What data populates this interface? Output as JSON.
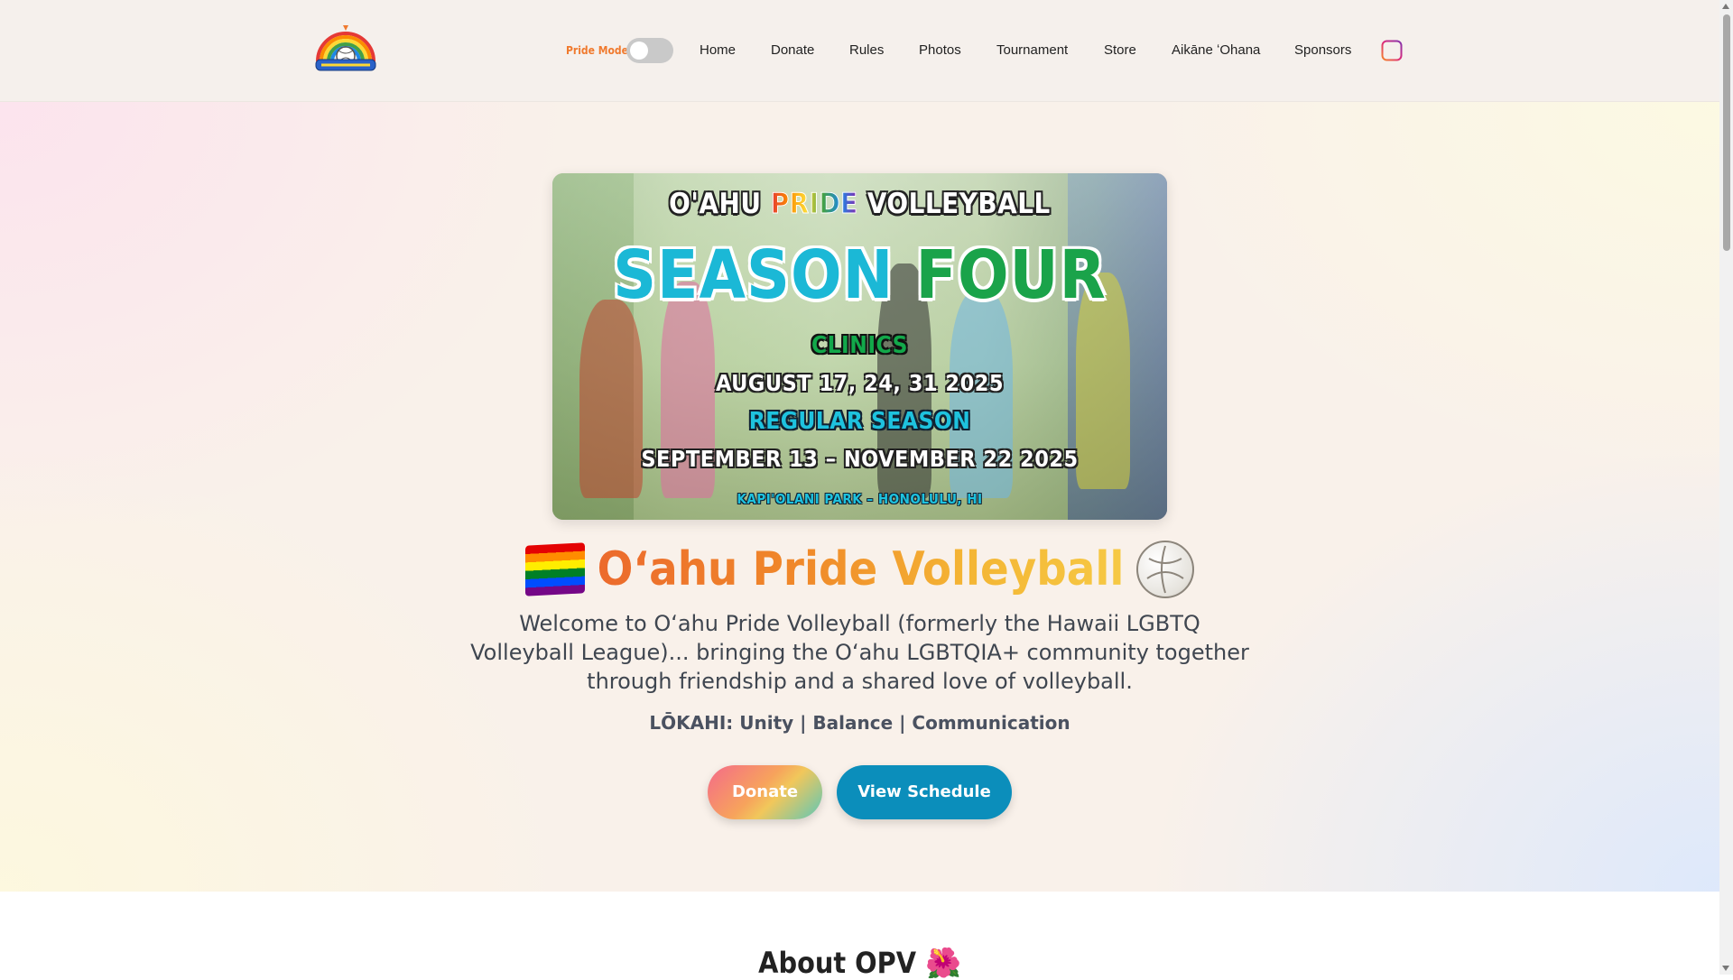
{
  "header": {
    "pride_mode_label": "Pride Mode",
    "pride_mode_on": false,
    "nav": [
      "Home",
      "Donate",
      "Rules",
      "Photos",
      "Tournament",
      "Store",
      "Aikāne ʻOhana",
      "Sponsors"
    ],
    "social_icon": "instagram-icon"
  },
  "banner": {
    "title_pre": "O'AHU ",
    "title_pride": "PRIDE",
    "title_post": " VOLLEYBALL",
    "season_word1": "SEASON",
    "season_word2": "FOUR",
    "clinics_label": "CLINICS",
    "clinics_dates": "AUGUST 17, 24, 31 2025",
    "regular_label": "REGULAR SEASON",
    "regular_dates": "SEPTEMBER 13 – NOVEMBER 22 2025",
    "location": "KAPI'OLANI PARK – HONOLULU, HI"
  },
  "hero": {
    "heading": "Oʻahu Pride Volleyball",
    "welcome": "Welcome to Oʻahu Pride Volleyball (formerly the Hawaii LGBTQ Volleyball League)... bringing the Oʻahu LGBTQIA+ community together through friendship and a shared love of volleyball.",
    "lokahi": "LŌKAHI: Unity | Balance | Communication",
    "donate_button": "Donate",
    "schedule_button": "View Schedule"
  },
  "about": {
    "title": "About OPV",
    "emoji": "🌺"
  },
  "colors": {
    "accent_orange": "#f07a2e",
    "schedule_blue": "#0b8ebb",
    "heading_gradient_start": "#ec6a2c",
    "heading_gradient_end": "#f6c944"
  }
}
